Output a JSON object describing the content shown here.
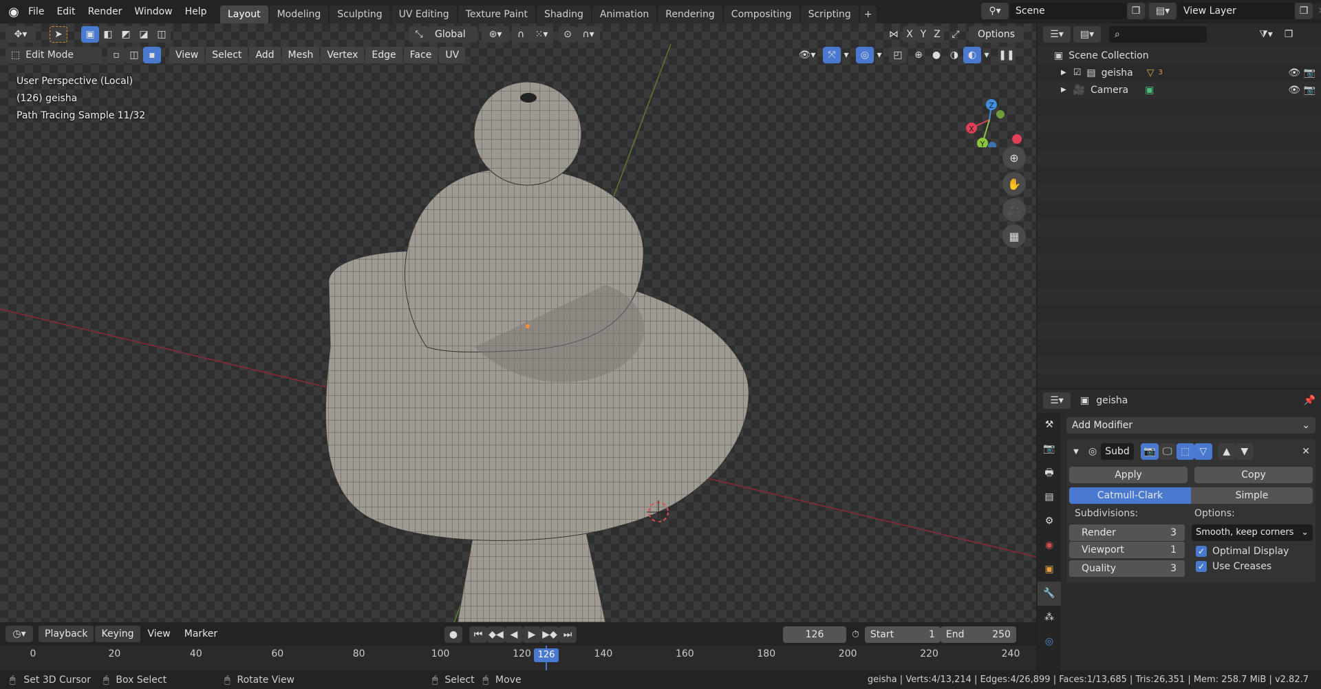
{
  "topbar": {
    "menus": [
      "File",
      "Edit",
      "Render",
      "Window",
      "Help"
    ],
    "workspaces": [
      "Layout",
      "Modeling",
      "Sculpting",
      "UV Editing",
      "Texture Paint",
      "Shading",
      "Animation",
      "Rendering",
      "Compositing",
      "Scripting"
    ],
    "active_workspace": "Layout",
    "scene": "Scene",
    "view_layer": "View Layer"
  },
  "viewport": {
    "orientation": "Global",
    "options_label": "Options",
    "axes": [
      "X",
      "Y",
      "Z"
    ],
    "mode": "Edit Mode",
    "menus": [
      "View",
      "Select",
      "Add",
      "Mesh",
      "Vertex",
      "Edge",
      "Face",
      "UV"
    ],
    "overlay_lines": [
      "User Perspective (Local)",
      "(126) geisha",
      "Path Tracing Sample 11/32"
    ],
    "gizmo": {
      "x": "X",
      "y": "Y",
      "z": "Z"
    }
  },
  "outliner": {
    "root": "Scene Collection",
    "items": [
      {
        "label": "geisha",
        "badge": "3"
      },
      {
        "label": "Camera"
      }
    ]
  },
  "properties": {
    "object_name": "geisha",
    "add_modifier": "Add Modifier",
    "modifier_name": "Subd",
    "apply": "Apply",
    "copy": "Copy",
    "type_options": [
      "Catmull-Clark",
      "Simple"
    ],
    "active_type": "Catmull-Clark",
    "subdivisions_label": "Subdivisions:",
    "options_label": "Options:",
    "fields": [
      {
        "label": "Render",
        "value": "3"
      },
      {
        "label": "Viewport",
        "value": "1"
      },
      {
        "label": "Quality",
        "value": "3"
      }
    ],
    "uv_smooth": "Smooth, keep corners",
    "checks": [
      {
        "label": "Optimal Display",
        "checked": true
      },
      {
        "label": "Use Creases",
        "checked": true
      }
    ]
  },
  "timeline": {
    "menus": [
      "Playback",
      "Keying",
      "View",
      "Marker"
    ],
    "current_frame": "126",
    "start_label": "Start",
    "start": "1",
    "end_label": "End",
    "end": "250",
    "ticks": [
      "0",
      "20",
      "40",
      "60",
      "80",
      "100",
      "120",
      "140",
      "160",
      "180",
      "200",
      "220",
      "240"
    ],
    "tick_values": [
      0,
      20,
      40,
      60,
      80,
      100,
      120,
      140,
      160,
      180,
      200,
      220,
      240
    ]
  },
  "statusbar": {
    "hints": [
      "Set 3D Cursor",
      "Box Select",
      "Rotate View",
      "Select",
      "Move"
    ],
    "stats": "geisha | Verts:4/13,214 | Edges:4/26,899 | Faces:1/13,685 | Tris:26,351 | Mem: 258.7 MiB | v2.82.7"
  },
  "colors": {
    "accent": "#4a7ad0",
    "x_axis": "#e04058",
    "y_axis": "#8cc63f",
    "z_axis": "#3f8ee0"
  }
}
